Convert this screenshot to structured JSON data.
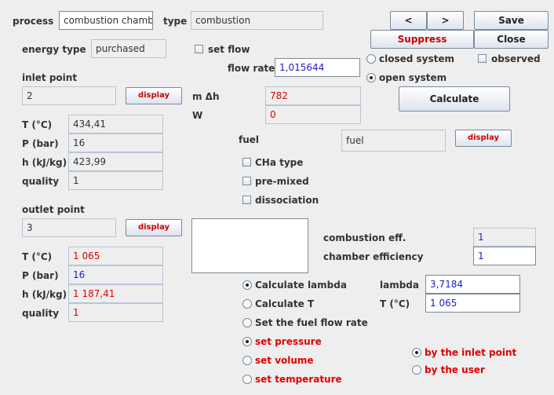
{
  "header": {
    "process_label": "process",
    "process_value": "combustion chamber",
    "type_label": "type",
    "type_value": "combustion",
    "prev_label": "<",
    "next_label": ">",
    "save_label": "Save",
    "suppress_label": "Suppress",
    "close_label": "Close"
  },
  "energy": {
    "label": "energy type",
    "value": "purchased"
  },
  "flow": {
    "set_flow_label": "set flow",
    "set_flow_checked": false,
    "flow_rate_label": "flow rate",
    "flow_rate_value": "1,015644"
  },
  "system": {
    "closed_label": "closed system",
    "open_label": "open system",
    "selected": "open",
    "observed_label": "observed",
    "observed_checked": false,
    "calculate_label": "Calculate"
  },
  "inlet": {
    "title": "inlet point",
    "point_value": "2",
    "display_label": "display",
    "rows": [
      {
        "label": "T (°C)",
        "value": "434,41"
      },
      {
        "label": "P (bar)",
        "value": "16"
      },
      {
        "label": "h (kJ/kg)",
        "value": "423,99"
      },
      {
        "label": "quality",
        "value": "1"
      }
    ]
  },
  "energy_balance": {
    "mdh_label": "m Δh",
    "mdh_value": "782",
    "w_label": "W",
    "w_value": "0"
  },
  "fuel": {
    "label": "fuel",
    "value": "fuel",
    "display_label": "display",
    "options": [
      {
        "label": "CHa type",
        "checked": false
      },
      {
        "label": "pre-mixed",
        "checked": false
      },
      {
        "label": "dissociation",
        "checked": false
      }
    ]
  },
  "outlet": {
    "title": "outlet point",
    "point_value": "3",
    "display_label": "display",
    "rows": [
      {
        "label": "T (°C)",
        "value": "1 065"
      },
      {
        "label": "P (bar)",
        "value": "16"
      },
      {
        "label": "h (kJ/kg)",
        "value": "1 187,41"
      },
      {
        "label": "quality",
        "value": "1"
      }
    ]
  },
  "efficiency": {
    "combustion_label": "combustion eff.",
    "combustion_value": "1",
    "chamber_label": "chamber efficiency",
    "chamber_value": "1"
  },
  "calc_mode": {
    "options": [
      {
        "label": "Calculate lambda",
        "selected": true
      },
      {
        "label": "Calculate T",
        "selected": false
      },
      {
        "label": "Set the fuel flow rate",
        "selected": false
      }
    ],
    "lambda_label": "lambda",
    "lambda_value": "3,7184",
    "t_label": "T (°C)",
    "t_value": "1 065"
  },
  "set_mode": {
    "options": [
      {
        "label": "set pressure",
        "selected": true
      },
      {
        "label": "set volume",
        "selected": false
      },
      {
        "label": "set temperature",
        "selected": false
      }
    ]
  },
  "reference": {
    "options": [
      {
        "label": "by the inlet point",
        "selected": true
      },
      {
        "label": "by the user",
        "selected": false
      }
    ]
  }
}
